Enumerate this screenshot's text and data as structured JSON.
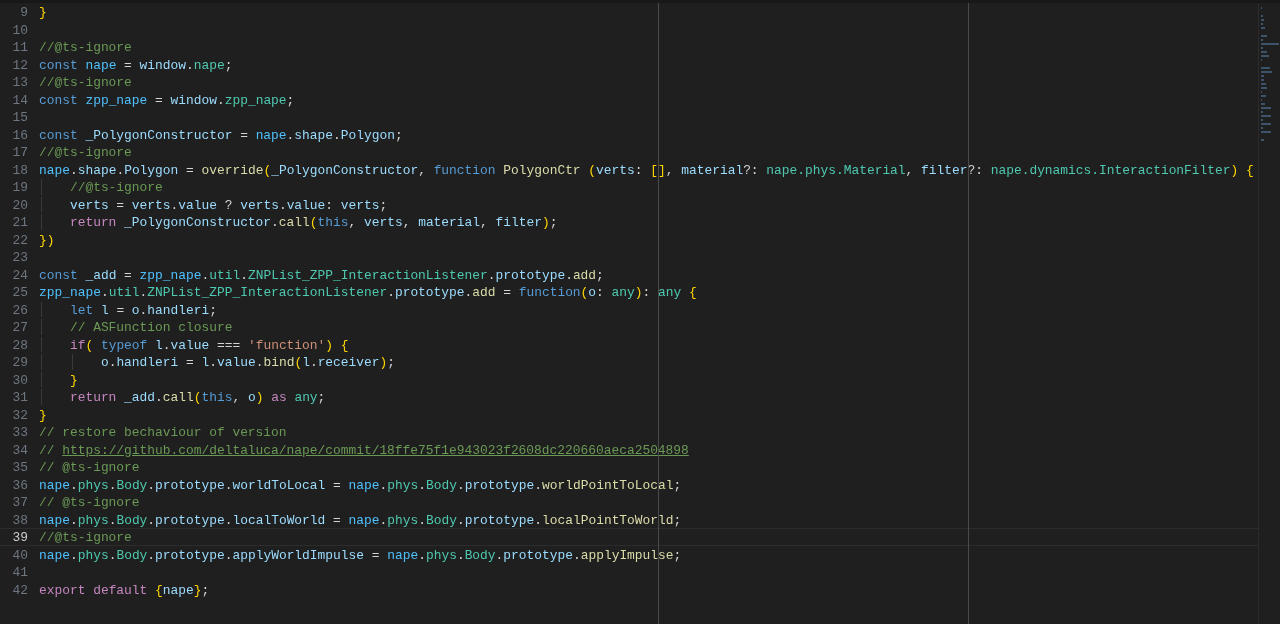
{
  "editor": {
    "lines": [
      {
        "number": "9",
        "current": false,
        "tokens": [
          {
            "text": "}",
            "kind": "br"
          }
        ]
      },
      {
        "number": "10",
        "current": false
      },
      {
        "number": "11",
        "current": false,
        "tokens": [
          {
            "text": "//@ts-ignore",
            "kind": "cmt"
          }
        ]
      },
      {
        "number": "12",
        "current": false,
        "tokens": [
          {
            "text": "const",
            "kind": "kw"
          },
          {
            "text": " nape",
            "kind": "const"
          },
          {
            "text": " = ",
            "kind": "p"
          },
          {
            "text": "window",
            "kind": "var"
          },
          {
            "text": ".",
            "kind": "p"
          },
          {
            "text": "nape",
            "kind": "type"
          },
          {
            "text": ";",
            "kind": "p"
          }
        ]
      },
      {
        "number": "13",
        "current": false,
        "tokens": [
          {
            "text": "//@ts-ignore",
            "kind": "cmt"
          }
        ]
      },
      {
        "number": "14",
        "current": false,
        "tokens": [
          {
            "text": "const",
            "kind": "kw"
          },
          {
            "text": " zpp_nape",
            "kind": "const"
          },
          {
            "text": " = ",
            "kind": "p"
          },
          {
            "text": "window",
            "kind": "var"
          },
          {
            "text": ".",
            "kind": "p"
          },
          {
            "text": "zpp_nape",
            "kind": "type"
          },
          {
            "text": ";",
            "kind": "p"
          }
        ]
      },
      {
        "number": "15",
        "current": false
      },
      {
        "number": "16",
        "current": false,
        "tokens": [
          {
            "text": "const",
            "kind": "kw"
          },
          {
            "text": " _PolygonConstructor",
            "kind": "var"
          },
          {
            "text": " = ",
            "kind": "p"
          },
          {
            "text": "nape",
            "kind": "const"
          },
          {
            "text": ".",
            "kind": "p"
          },
          {
            "text": "shape",
            "kind": "var"
          },
          {
            "text": ".",
            "kind": "p"
          },
          {
            "text": "Polygon",
            "kind": "var"
          },
          {
            "text": ";",
            "kind": "p"
          }
        ]
      },
      {
        "number": "17",
        "current": false,
        "tokens": [
          {
            "text": "//@ts-ignore",
            "kind": "cmt"
          }
        ]
      },
      {
        "number": "18",
        "current": false,
        "tokens": [
          {
            "text": "nape",
            "kind": "const"
          },
          {
            "text": ".",
            "kind": "p"
          },
          {
            "text": "shape",
            "kind": "var"
          },
          {
            "text": ".",
            "kind": "p"
          },
          {
            "text": "Polygon",
            "kind": "var"
          },
          {
            "text": " = ",
            "kind": "p"
          },
          {
            "text": "override",
            "kind": "fn"
          },
          {
            "text": "(",
            "kind": "br"
          },
          {
            "text": "_PolygonConstructor",
            "kind": "var"
          },
          {
            "text": ", ",
            "kind": "p"
          },
          {
            "text": "function",
            "kind": "kw"
          },
          {
            "text": " PolygonCtr",
            "kind": "fn"
          },
          {
            "text": " (",
            "kind": "br"
          },
          {
            "text": "verts",
            "kind": "var"
          },
          {
            "text": ": ",
            "kind": "p"
          },
          {
            "text": "[]",
            "kind": "br"
          },
          {
            "text": ", ",
            "kind": "p"
          },
          {
            "text": "material",
            "kind": "var"
          },
          {
            "text": "?: ",
            "kind": "p"
          },
          {
            "text": "nape.phys.Material",
            "kind": "type"
          },
          {
            "text": ", ",
            "kind": "p"
          },
          {
            "text": "filter",
            "kind": "var"
          },
          {
            "text": "?: ",
            "kind": "p"
          },
          {
            "text": "nape.dynamics.InteractionFilter",
            "kind": "type"
          },
          {
            "text": ")",
            "kind": "br"
          },
          {
            "text": " {",
            "kind": "br"
          }
        ]
      },
      {
        "number": "19",
        "current": false,
        "tokens": [
          {
            "text": "    //@ts-ignore",
            "kind": "cmt"
          }
        ]
      },
      {
        "number": "20",
        "current": false,
        "tokens": [
          {
            "text": "    verts",
            "kind": "var"
          },
          {
            "text": " = ",
            "kind": "p"
          },
          {
            "text": "verts",
            "kind": "var"
          },
          {
            "text": ".",
            "kind": "p"
          },
          {
            "text": "value",
            "kind": "var"
          },
          {
            "text": " ? ",
            "kind": "p"
          },
          {
            "text": "verts",
            "kind": "var"
          },
          {
            "text": ".",
            "kind": "p"
          },
          {
            "text": "value",
            "kind": "var"
          },
          {
            "text": ": ",
            "kind": "p"
          },
          {
            "text": "verts",
            "kind": "var"
          },
          {
            "text": ";",
            "kind": "p"
          }
        ]
      },
      {
        "number": "21",
        "current": false,
        "tokens": [
          {
            "text": "    return",
            "kind": "ctrl"
          },
          {
            "text": " _PolygonConstructor",
            "kind": "var"
          },
          {
            "text": ".",
            "kind": "p"
          },
          {
            "text": "call",
            "kind": "fn"
          },
          {
            "text": "(",
            "kind": "br"
          },
          {
            "text": "this",
            "kind": "kw"
          },
          {
            "text": ", ",
            "kind": "p"
          },
          {
            "text": "verts",
            "kind": "var"
          },
          {
            "text": ", ",
            "kind": "p"
          },
          {
            "text": "material",
            "kind": "var"
          },
          {
            "text": ", ",
            "kind": "p"
          },
          {
            "text": "filter",
            "kind": "var"
          },
          {
            "text": ")",
            "kind": "br"
          },
          {
            "text": ";",
            "kind": "p"
          }
        ]
      },
      {
        "number": "22",
        "current": false,
        "tokens": [
          {
            "text": "})",
            "kind": "br"
          }
        ]
      },
      {
        "number": "23",
        "current": false
      },
      {
        "number": "24",
        "current": false,
        "tokens": [
          {
            "text": "const",
            "kind": "kw"
          },
          {
            "text": " _add",
            "kind": "var"
          },
          {
            "text": " = ",
            "kind": "p"
          },
          {
            "text": "zpp_nape",
            "kind": "const"
          },
          {
            "text": ".",
            "kind": "p"
          },
          {
            "text": "util",
            "kind": "type"
          },
          {
            "text": ".",
            "kind": "p"
          },
          {
            "text": "ZNPList_ZPP_InteractionListener",
            "kind": "type"
          },
          {
            "text": ".",
            "kind": "p"
          },
          {
            "text": "prototype",
            "kind": "var"
          },
          {
            "text": ".",
            "kind": "p"
          },
          {
            "text": "add",
            "kind": "fn"
          },
          {
            "text": ";",
            "kind": "p"
          }
        ]
      },
      {
        "number": "25",
        "current": false,
        "tokens": [
          {
            "text": "zpp_nape",
            "kind": "const"
          },
          {
            "text": ".",
            "kind": "p"
          },
          {
            "text": "util",
            "kind": "type"
          },
          {
            "text": ".",
            "kind": "p"
          },
          {
            "text": "ZNPList_ZPP_InteractionListener",
            "kind": "type"
          },
          {
            "text": ".",
            "kind": "p"
          },
          {
            "text": "prototype",
            "kind": "var"
          },
          {
            "text": ".",
            "kind": "p"
          },
          {
            "text": "add",
            "kind": "fn"
          },
          {
            "text": " = ",
            "kind": "p"
          },
          {
            "text": "function",
            "kind": "kw"
          },
          {
            "text": "(",
            "kind": "br"
          },
          {
            "text": "o",
            "kind": "var"
          },
          {
            "text": ": ",
            "kind": "p"
          },
          {
            "text": "any",
            "kind": "type"
          },
          {
            "text": ")",
            "kind": "br"
          },
          {
            "text": ": ",
            "kind": "p"
          },
          {
            "text": "any",
            "kind": "type"
          },
          {
            "text": " {",
            "kind": "br"
          }
        ]
      },
      {
        "number": "26",
        "current": false,
        "tokens": [
          {
            "text": "    let",
            "kind": "kw"
          },
          {
            "text": " l",
            "kind": "var"
          },
          {
            "text": " = ",
            "kind": "p"
          },
          {
            "text": "o",
            "kind": "var"
          },
          {
            "text": ".",
            "kind": "p"
          },
          {
            "text": "handleri",
            "kind": "var"
          },
          {
            "text": ";",
            "kind": "p"
          }
        ]
      },
      {
        "number": "27",
        "current": false,
        "tokens": [
          {
            "text": "    // ASFunction closure",
            "kind": "cmt"
          }
        ]
      },
      {
        "number": "28",
        "current": false,
        "tokens": [
          {
            "text": "    if",
            "kind": "ctrl"
          },
          {
            "text": "(",
            "kind": "br"
          },
          {
            "text": " typeof",
            "kind": "kw"
          },
          {
            "text": " l",
            "kind": "var"
          },
          {
            "text": ".",
            "kind": "p"
          },
          {
            "text": "value",
            "kind": "var"
          },
          {
            "text": " === ",
            "kind": "p"
          },
          {
            "text": "'function'",
            "kind": "str"
          },
          {
            "text": ")",
            "kind": "br"
          },
          {
            "text": " {",
            "kind": "br"
          }
        ]
      },
      {
        "number": "29",
        "current": false,
        "tokens": [
          {
            "text": "        o",
            "kind": "var"
          },
          {
            "text": ".",
            "kind": "p"
          },
          {
            "text": "handleri",
            "kind": "var"
          },
          {
            "text": " = ",
            "kind": "p"
          },
          {
            "text": "l",
            "kind": "var"
          },
          {
            "text": ".",
            "kind": "p"
          },
          {
            "text": "value",
            "kind": "var"
          },
          {
            "text": ".",
            "kind": "p"
          },
          {
            "text": "bind",
            "kind": "fn"
          },
          {
            "text": "(",
            "kind": "br"
          },
          {
            "text": "l",
            "kind": "var"
          },
          {
            "text": ".",
            "kind": "p"
          },
          {
            "text": "receiver",
            "kind": "var"
          },
          {
            "text": ")",
            "kind": "br"
          },
          {
            "text": ";",
            "kind": "p"
          }
        ]
      },
      {
        "number": "30",
        "current": false,
        "tokens": [
          {
            "text": "    }",
            "kind": "br"
          }
        ]
      },
      {
        "number": "31",
        "current": false,
        "tokens": [
          {
            "text": "    return",
            "kind": "ctrl"
          },
          {
            "text": " _add",
            "kind": "var"
          },
          {
            "text": ".",
            "kind": "p"
          },
          {
            "text": "call",
            "kind": "fn"
          },
          {
            "text": "(",
            "kind": "br"
          },
          {
            "text": "this",
            "kind": "kw"
          },
          {
            "text": ", ",
            "kind": "p"
          },
          {
            "text": "o",
            "kind": "var"
          },
          {
            "text": ")",
            "kind": "br"
          },
          {
            "text": " as",
            "kind": "ctrl"
          },
          {
            "text": " any",
            "kind": "type"
          },
          {
            "text": ";",
            "kind": "p"
          }
        ]
      },
      {
        "number": "32",
        "current": false,
        "tokens": [
          {
            "text": "}",
            "kind": "br"
          }
        ]
      },
      {
        "number": "33",
        "current": false,
        "tokens": [
          {
            "text": "// restore bechaviour of version",
            "kind": "cmt"
          }
        ]
      },
      {
        "number": "34",
        "current": false,
        "tokens": [
          {
            "text": "//",
            "kind": "cmt"
          },
          {
            "text": "https://github.com/deltaluca/nape/commit/18ffe75f1e943023f2608dc220660aeca2504898",
            "kind": "link"
          }
        ]
      },
      {
        "number": "35",
        "current": false,
        "tokens": [
          {
            "text": "// @ts-ignore",
            "kind": "cmt"
          }
        ]
      },
      {
        "number": "36",
        "current": false,
        "tokens": [
          {
            "text": "nape",
            "kind": "const"
          },
          {
            "text": ".",
            "kind": "p"
          },
          {
            "text": "phys",
            "kind": "type"
          },
          {
            "text": ".",
            "kind": "p"
          },
          {
            "text": "Body",
            "kind": "type"
          },
          {
            "text": ".",
            "kind": "p"
          },
          {
            "text": "prototype",
            "kind": "var"
          },
          {
            "text": ".",
            "kind": "p"
          },
          {
            "text": "worldToLocal",
            "kind": "var"
          },
          {
            "text": " = ",
            "kind": "p"
          },
          {
            "text": "nape",
            "kind": "const"
          },
          {
            "text": ".",
            "kind": "p"
          },
          {
            "text": "phys",
            "kind": "type"
          },
          {
            "text": ".",
            "kind": "p"
          },
          {
            "text": "Body",
            "kind": "type"
          },
          {
            "text": ".",
            "kind": "p"
          },
          {
            "text": "prototype",
            "kind": "var"
          },
          {
            "text": ".",
            "kind": "p"
          },
          {
            "text": "worldPointToLocal",
            "kind": "fn"
          },
          {
            "text": ";",
            "kind": "p"
          }
        ]
      },
      {
        "number": "37",
        "current": false,
        "tokens": [
          {
            "text": "// @ts-ignore",
            "kind": "cmt"
          }
        ]
      },
      {
        "number": "38",
        "current": false,
        "tokens": [
          {
            "text": "nape",
            "kind": "const"
          },
          {
            "text": ".",
            "kind": "p"
          },
          {
            "text": "phys",
            "kind": "type"
          },
          {
            "text": ".",
            "kind": "p"
          },
          {
            "text": "Body",
            "kind": "type"
          },
          {
            "text": ".",
            "kind": "p"
          },
          {
            "text": "prototype",
            "kind": "var"
          },
          {
            "text": ".",
            "kind": "p"
          },
          {
            "text": "localToWorld",
            "kind": "var"
          },
          {
            "text": " = ",
            "kind": "p"
          },
          {
            "text": "nape",
            "kind": "const"
          },
          {
            "text": ".",
            "kind": "p"
          },
          {
            "text": "phys",
            "kind": "type"
          },
          {
            "text": ".",
            "kind": "p"
          },
          {
            "text": "Body",
            "kind": "type"
          },
          {
            "text": ".",
            "kind": "p"
          },
          {
            "text": "prototype",
            "kind": "var"
          },
          {
            "text": ".",
            "kind": "p"
          },
          {
            "text": "localPointToWorld",
            "kind": "fn"
          },
          {
            "text": ";",
            "kind": "p"
          }
        ]
      },
      {
        "number": "39",
        "current": true,
        "tokens": [
          {
            "text": "//@ts-ignore",
            "kind": "cmt"
          }
        ]
      },
      {
        "number": "40",
        "current": false,
        "tokens": [
          {
            "text": "nape",
            "kind": "const"
          },
          {
            "text": ".",
            "kind": "p"
          },
          {
            "text": "phys",
            "kind": "type"
          },
          {
            "text": ".",
            "kind": "p"
          },
          {
            "text": "Body",
            "kind": "type"
          },
          {
            "text": ".",
            "kind": "p"
          },
          {
            "text": "prototype",
            "kind": "var"
          },
          {
            "text": ".",
            "kind": "p"
          },
          {
            "text": "applyWorldImpulse",
            "kind": "var"
          },
          {
            "text": " = ",
            "kind": "p"
          },
          {
            "text": "nape",
            "kind": "const"
          },
          {
            "text": ".",
            "kind": "p"
          },
          {
            "text": "phys",
            "kind": "type"
          },
          {
            "text": ".",
            "kind": "p"
          },
          {
            "text": "Body",
            "kind": "type"
          },
          {
            "text": ".",
            "kind": "p"
          },
          {
            "text": "prototype",
            "kind": "var"
          },
          {
            "text": ".",
            "kind": "p"
          },
          {
            "text": "applyImpulse",
            "kind": "fn"
          },
          {
            "text": ";",
            "kind": "p"
          }
        ]
      },
      {
        "number": "41",
        "current": false
      },
      {
        "number": "42",
        "current": false,
        "tokens": [
          {
            "text": "export",
            "kind": "ctrl"
          },
          {
            "text": " default",
            "kind": "ctrl"
          },
          {
            "text": " {",
            "kind": "br"
          },
          {
            "text": "nape",
            "kind": "var"
          },
          {
            "text": "}",
            "kind": "br"
          },
          {
            "text": ";",
            "kind": "p"
          }
        ]
      }
    ]
  }
}
